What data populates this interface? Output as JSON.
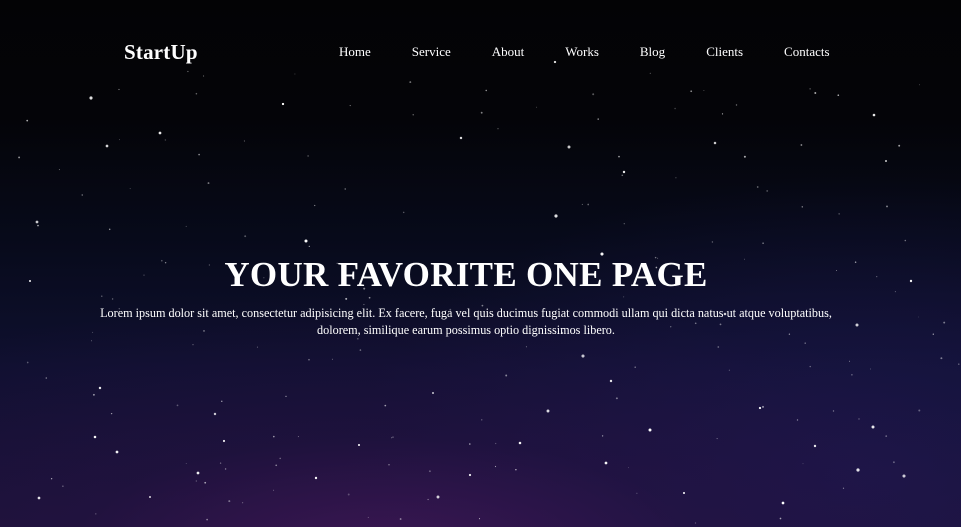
{
  "brand": {
    "logo_text": "StartUp"
  },
  "nav": {
    "items": [
      {
        "label": "Home"
      },
      {
        "label": "Service"
      },
      {
        "label": "About"
      },
      {
        "label": "Works"
      },
      {
        "label": "Blog"
      },
      {
        "label": "Clients"
      },
      {
        "label": "Contacts"
      }
    ]
  },
  "hero": {
    "headline": "YOUR FAVORITE ONE PAGE",
    "subtext": "Lorem ipsum dolor sit amet, consectetur adipisicing elit. Ex facere, fuga vel quis ducimus fugiat commodi ullam qui dicta natus ut atque voluptatibus, dolorem, similique earum possimus optio dignissimos libero."
  },
  "colors": {
    "text": "#ffffff",
    "background_top": "#030305",
    "background_bottom": "#1b1238",
    "star": "#ffffff"
  }
}
